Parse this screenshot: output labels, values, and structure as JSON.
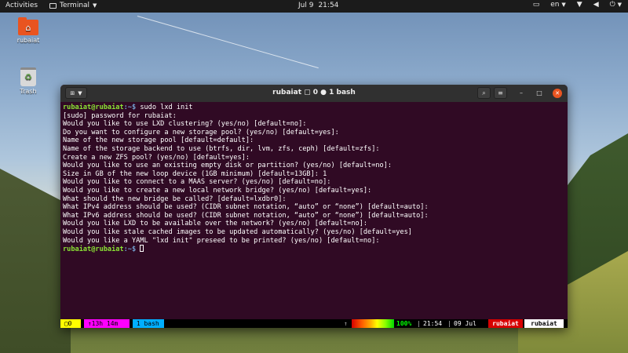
{
  "topbar": {
    "activities": "Activities",
    "app_name": "Terminal",
    "date": "Jul 9",
    "time": "21:54",
    "language": "en",
    "indicators": [
      "network-icon",
      "volume-icon",
      "power-icon",
      "display-icon"
    ]
  },
  "desktop": {
    "icons": [
      {
        "label": "rubaiat",
        "icon": "home-folder-icon"
      },
      {
        "label": "Trash",
        "icon": "trash-icon"
      }
    ]
  },
  "window": {
    "title": "rubaiat ▢ 0 ● 1 bash"
  },
  "terminal": {
    "prompt_user": "rubaiat@rubaiat",
    "prompt_path": ":~$",
    "command": " sudo lxd init",
    "lines": [
      "[sudo] password for rubaiat:",
      "Would you like to use LXD clustering? (yes/no) [default=no]:",
      "Do you want to configure a new storage pool? (yes/no) [default=yes]:",
      "Name of the new storage pool [default=default]:",
      "Name of the storage backend to use (btrfs, dir, lvm, zfs, ceph) [default=zfs]:",
      "Create a new ZFS pool? (yes/no) [default=yes]:",
      "Would you like to use an existing empty disk or partition? (yes/no) [default=no]:",
      "Size in GB of the new loop device (1GB minimum) [default=13GB]: 1",
      "Would you like to connect to a MAAS server? (yes/no) [default=no]:",
      "Would you like to create a new local network bridge? (yes/no) [default=yes]:",
      "What should the new bridge be called? [default=lxdbr0]:",
      "What IPv4 address should be used? (CIDR subnet notation, “auto” or “none”) [default=auto]:",
      "What IPv6 address should be used? (CIDR subnet notation, “auto” or “none”) [default=auto]:",
      "Would you like LXD to be available over the network? (yes/no) [default=no]:",
      "Would you like stale cached images to be updated automatically? (yes/no) [default=yes]",
      "Would you like a YAML \"lxd init\" preseed to be printed? (yes/no) [default=no]:"
    ]
  },
  "status": {
    "session": "0",
    "uptime": "13h 14m",
    "window": "1 bash",
    "arrow": "↑",
    "battery": "100%",
    "clock": "21:54",
    "date": "09 Jul",
    "user": "rubaiat",
    "host": "rubaiat",
    "battery_level": 1.0
  }
}
